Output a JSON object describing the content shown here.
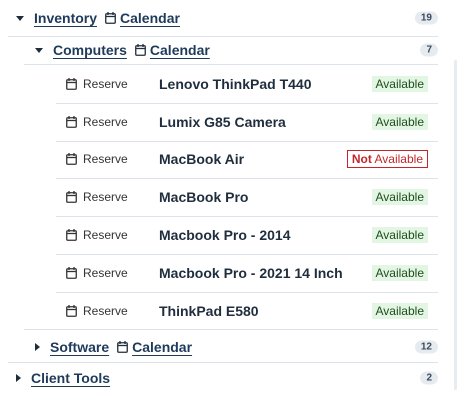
{
  "groups": {
    "inventory": {
      "label": "Inventory",
      "calendar_label": "Calendar",
      "count": "19"
    },
    "computers": {
      "label": "Computers",
      "calendar_label": "Calendar",
      "count": "7"
    },
    "software": {
      "label": "Software",
      "calendar_label": "Calendar",
      "count": "12"
    },
    "client_tools": {
      "label": "Client Tools",
      "count": "2"
    }
  },
  "items": [
    {
      "reserve_label": "Reserve",
      "name": "Lenovo ThinkPad T440",
      "status": "Available"
    },
    {
      "reserve_label": "Reserve",
      "name": "Lumix G85 Camera",
      "status": "Available"
    },
    {
      "reserve_label": "Reserve",
      "name": "MacBook Air",
      "status_prefix": "Not",
      "status": "Available"
    },
    {
      "reserve_label": "Reserve",
      "name": "MacBook Pro",
      "status": "Available"
    },
    {
      "reserve_label": "Reserve",
      "name": "Macbook Pro - 2014",
      "status": "Available"
    },
    {
      "reserve_label": "Reserve",
      "name": "Macbook Pro - 2021 14 Inch",
      "status": "Available"
    },
    {
      "reserve_label": "Reserve",
      "name": "ThinkPad E580",
      "status": "Available"
    }
  ],
  "colors": {
    "available_bg": "#e3f6e3",
    "not_available": "#c0282d",
    "badge_bg": "#e6ebf0",
    "link": "#1f3a5a"
  },
  "icons": [
    "chevron-down-icon",
    "chevron-right-icon",
    "calendar-icon"
  ]
}
